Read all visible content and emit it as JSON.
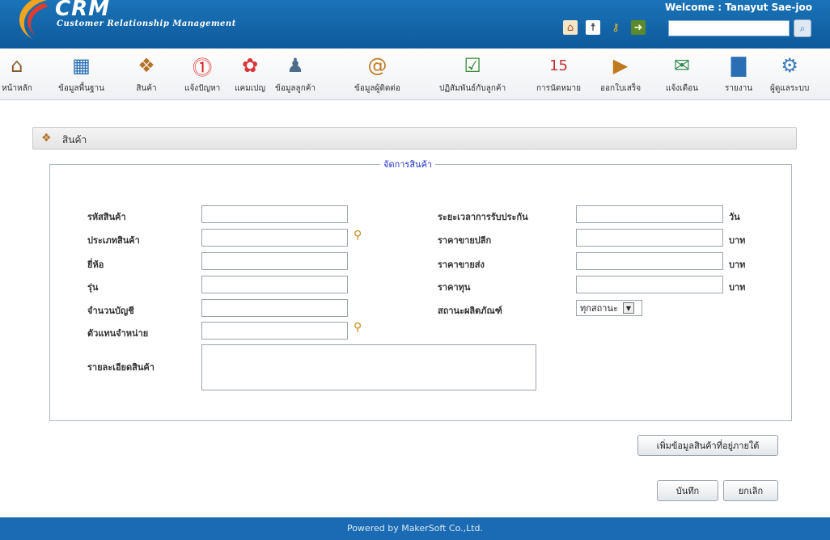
{
  "header": {
    "logo_title": "CRM",
    "logo_subtitle": "Customer Relationship Management",
    "welcome": "Welcome : Tanayut Sae-joo",
    "icons": [
      "home-icon",
      "accessibility-icon",
      "key-icon",
      "logout-icon"
    ],
    "search_placeholder": ""
  },
  "toolbar": [
    {
      "label": "หน้าหลัก",
      "icon": "home-icon"
    },
    {
      "label": "ข้อมูลพื้นฐาน",
      "icon": "data-icon"
    },
    {
      "label": "สินค้า",
      "icon": "product-icon"
    },
    {
      "label": "แจ้งปัญหา",
      "icon": "alert-icon"
    },
    {
      "label": "แคมเปญ",
      "icon": "gift-icon"
    },
    {
      "label": "ข้อมูลลูกค้า",
      "icon": "customer-icon"
    },
    {
      "label": "ข้อมูลผู้ติดต่อ",
      "icon": "contact-book-icon"
    },
    {
      "label": "ปฏิสัมพันธ์กับลูกค้า",
      "icon": "checklist-icon"
    },
    {
      "label": "การนัดหมาย",
      "icon": "calendar-icon"
    },
    {
      "label": "ออกใบเสร็จ",
      "icon": "receipt-icon"
    },
    {
      "label": "แจ้งเตือน",
      "icon": "notify-icon"
    },
    {
      "label": "รายงาน",
      "icon": "report-icon"
    },
    {
      "label": "ผู้ดูแลระบบ",
      "icon": "admin-gear-icon"
    }
  ],
  "panel": {
    "title": "สินค้า",
    "legend": "จัดการสินค้า"
  },
  "form": {
    "left": [
      {
        "label": "รหัสสินค้า",
        "value": ""
      },
      {
        "label": "ประเภทสินค้า",
        "value": ""
      },
      {
        "label": "ยี่ห้อ",
        "value": ""
      },
      {
        "label": "รุ่น",
        "value": ""
      },
      {
        "label": "จำนวนบัญชี",
        "value": ""
      },
      {
        "label": "ตัวแทนจำหน่าย",
        "value": ""
      }
    ],
    "detail_label": "รายละเอียดสินค้า",
    "detail_value": "",
    "right": [
      {
        "label": "ระยะเวลาการรับประกัน",
        "value": "",
        "unit": "วัน"
      },
      {
        "label": "ราคาขายปลีก",
        "value": "",
        "unit": "บาท"
      },
      {
        "label": "ราคาขายส่ง",
        "value": "",
        "unit": "บาท"
      },
      {
        "label": "ราคาทุน",
        "value": "",
        "unit": "บาท"
      }
    ],
    "status_label": "สถานะผลิตภัณฑ์",
    "status_selected": "ทุกสถานะ"
  },
  "buttons": {
    "add_sub": "เพิ่มข้อมูลสินค้าที่อยู่ภายใต้",
    "save": "บันทึก",
    "cancel": "ยกเลิก"
  },
  "footer": "Powered by MakerSoft Co.,Ltd."
}
